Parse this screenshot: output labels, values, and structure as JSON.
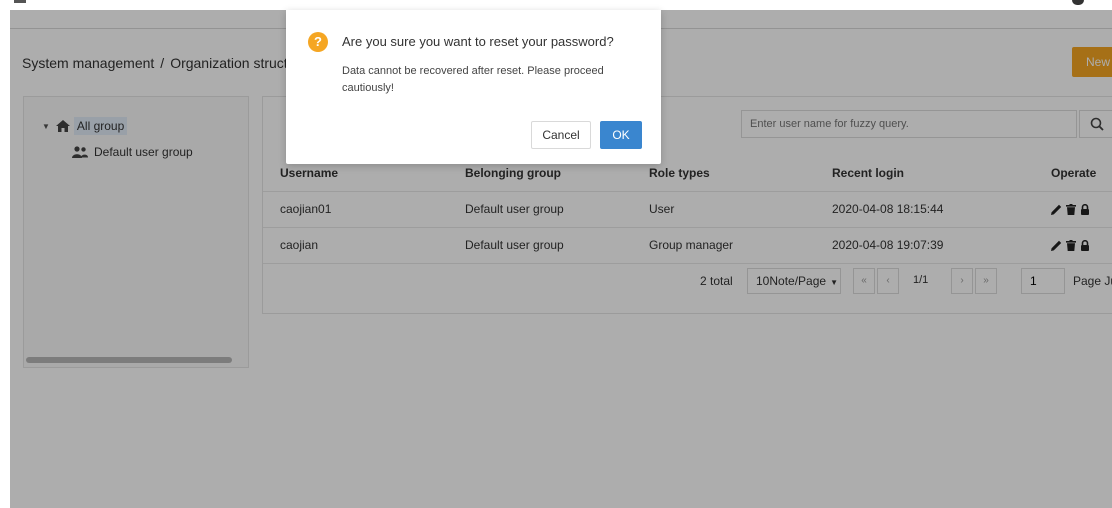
{
  "header": {
    "icons": {
      "menu": "menu-icon",
      "avatar": "user-avatar"
    }
  },
  "breadcrumb": {
    "parent": "System management",
    "separator": "/",
    "current": "Organization structure"
  },
  "toolbar": {
    "new_label": "New"
  },
  "tree": {
    "root": {
      "label": "All group",
      "icon": "home-icon",
      "expanded": true
    },
    "children": [
      {
        "label": "Default user group",
        "icon": "users-icon"
      }
    ]
  },
  "search": {
    "placeholder": "Enter user name for fuzzy query.",
    "icon": "search-icon"
  },
  "table": {
    "columns": [
      "Username",
      "Belonging group",
      "Role types",
      "Recent login",
      "Operate"
    ],
    "rows": [
      {
        "username": "caojian01",
        "group": "Default user group",
        "role": "User",
        "login": "2020-04-08 18:15:44",
        "operate": [
          "edit-icon",
          "delete-icon",
          "lock-icon"
        ]
      },
      {
        "username": "caojian",
        "group": "Default user group",
        "role": "Group manager",
        "login": "2020-04-08 19:07:39",
        "operate": [
          "edit-icon",
          "delete-icon",
          "lock-icon"
        ]
      }
    ]
  },
  "pagination": {
    "total": "2 total",
    "page_size": "10Note/Page",
    "first": "«",
    "prev": "‹",
    "indicator": "1/1",
    "next": "›",
    "last": "»",
    "page_input": "1",
    "jump_label": "Page Ju"
  },
  "dialog": {
    "title": "Are you sure you want to reset your password?",
    "message": "Data cannot be recovered after reset. Please proceed cautiously!",
    "icon": "?",
    "icon_name": "warning-icon",
    "icon_color": "#f5a623",
    "cancel_label": "Cancel",
    "ok_label": "OK",
    "ok_color": "#3a86cf"
  },
  "colors": {
    "accent": "#f5a623",
    "primary": "#3a86cf",
    "tree_selected_bg": "#e2ecf8"
  }
}
